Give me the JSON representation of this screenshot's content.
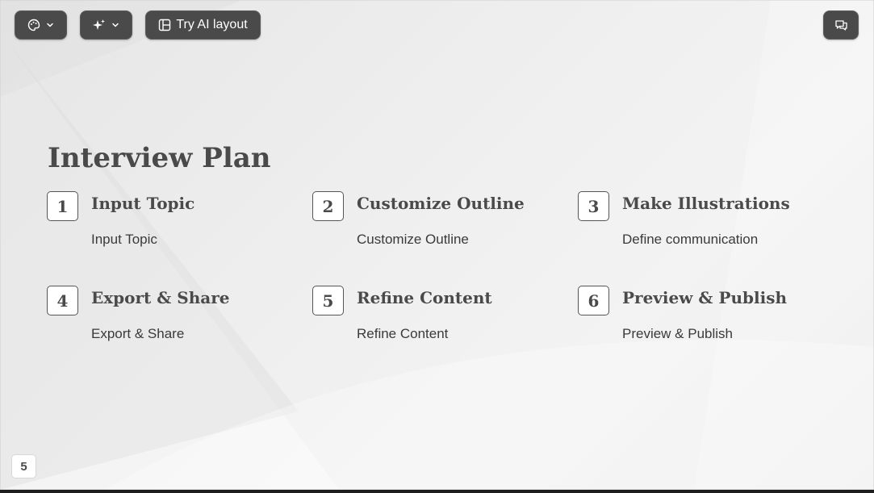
{
  "toolbar": {
    "theme_icon": "palette-icon",
    "magic_icon": "sparkles-icon",
    "ai_layout_icon": "layout-icon",
    "ai_layout_label": "Try AI layout",
    "comments_icon": "comments-icon"
  },
  "slide": {
    "title": "Interview Plan",
    "steps": [
      {
        "number": "1",
        "title": "Input Topic",
        "description": "Input Topic"
      },
      {
        "number": "2",
        "title": "Customize Outline",
        "description": "Customize Outline"
      },
      {
        "number": "3",
        "title": "Make Illustrations",
        "description": "Define communication"
      },
      {
        "number": "4",
        "title": "Export & Share",
        "description": "Export & Share"
      },
      {
        "number": "5",
        "title": "Refine Content",
        "description": "Refine Content"
      },
      {
        "number": "6",
        "title": "Preview & Publish",
        "description": "Preview & Publish"
      }
    ],
    "page_number": "5"
  },
  "colors": {
    "toolbar_bg": "#4a4a4a",
    "text_dark": "#4a4a4a",
    "slide_bg": "#efefef"
  }
}
